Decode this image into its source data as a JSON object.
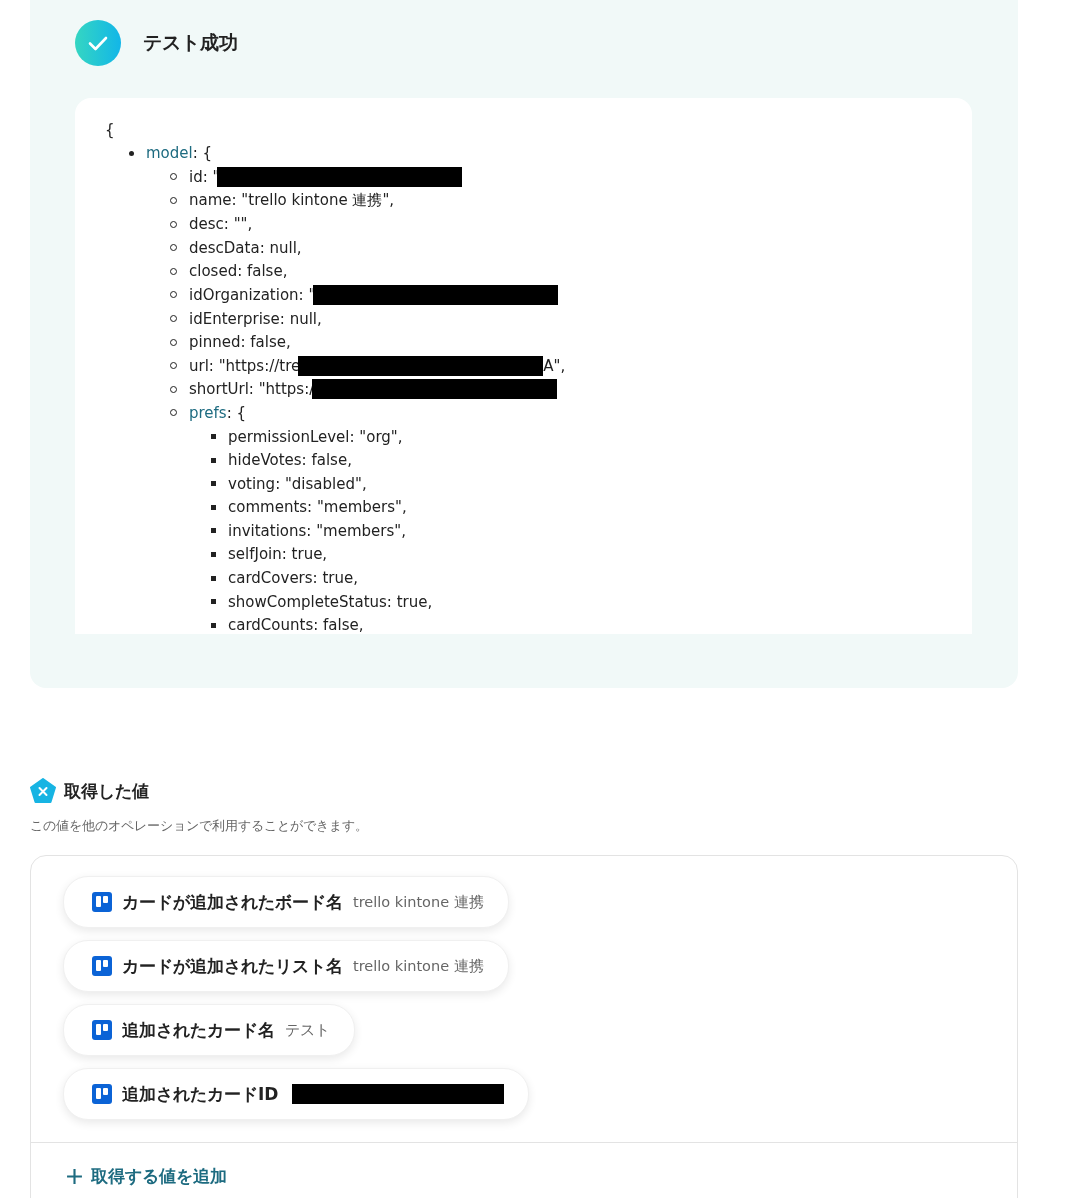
{
  "test_result": {
    "title": "テスト成功",
    "open_brace": "{",
    "items": [
      {
        "key": "model",
        "suffix": ": {",
        "children": [
          {
            "text": "id: \"",
            "redacted": true
          },
          {
            "text": "name: \"trello kintone 連携\","
          },
          {
            "text": "desc: \"\","
          },
          {
            "text": "descData: null,"
          },
          {
            "text": "closed: false,"
          },
          {
            "text": "idOrganization: \"",
            "redacted": true
          },
          {
            "text": "idEnterprise: null,"
          },
          {
            "text": "pinned: false,"
          },
          {
            "text": "url: \"https://tre",
            "redacted": true,
            "tail": "A\","
          },
          {
            "text": "shortUrl: \"https:/",
            "redacted": true
          },
          {
            "key": "prefs",
            "suffix": ": {",
            "children": [
              {
                "text": "permissionLevel: \"org\","
              },
              {
                "text": "hideVotes: false,"
              },
              {
                "text": "voting: \"disabled\","
              },
              {
                "text": "comments: \"members\","
              },
              {
                "text": "invitations: \"members\","
              },
              {
                "text": "selfJoin: true,"
              },
              {
                "text": "cardCovers: true,"
              },
              {
                "text": "showCompleteStatus: true,"
              },
              {
                "text": "cardCounts: false,"
              }
            ]
          }
        ]
      }
    ]
  },
  "acquired": {
    "title": "取得した値",
    "description": "この値を他のオペレーションで利用することができます。",
    "values": [
      {
        "label": "カードが追加されたボード名",
        "value": "trello kintone 連携"
      },
      {
        "label": "カードが追加されたリスト名",
        "value": "trello kintone 連携"
      },
      {
        "label": "追加されたカード名",
        "value": "テスト"
      },
      {
        "label": "追加されたカードID",
        "redacted": true
      }
    ],
    "add_button": "取得する値を追加"
  }
}
